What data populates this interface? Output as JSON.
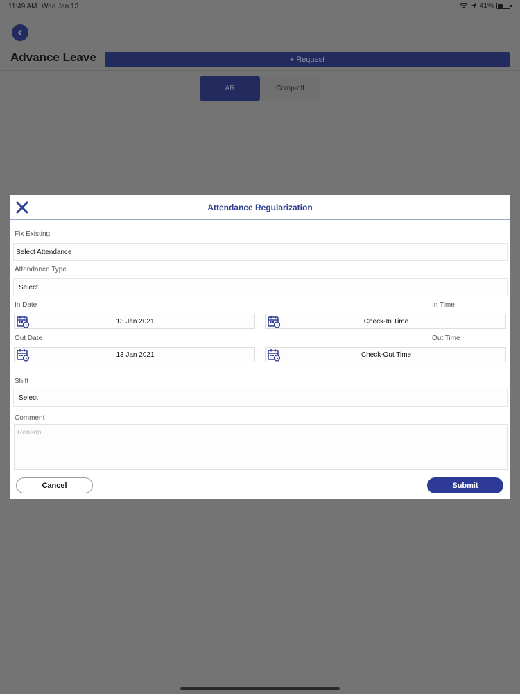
{
  "status_bar": {
    "time": "11:49 AM",
    "date": "Wed Jan 13",
    "battery_text": "41%",
    "battery_level": 0.41
  },
  "header": {
    "back_icon": "chevron-left-icon",
    "title": "Advance Leave",
    "request_label": "+ Request"
  },
  "segments": [
    {
      "label": "AR",
      "active": true
    },
    {
      "label": "Comp-off",
      "active": false
    }
  ],
  "modal": {
    "close_icon": "close-icon",
    "title": "Attendance Regularization",
    "fix_existing": {
      "label": "Fix Existing",
      "value": "Select Attendance"
    },
    "attendance_type": {
      "label": "Attendance Type",
      "value": "Select"
    },
    "in_date": {
      "label": "In Date",
      "value": "13 Jan 2021"
    },
    "in_time": {
      "label": "In Time",
      "value": "Check-In Time"
    },
    "out_date": {
      "label": "Out Date",
      "value": "13 Jan 2021"
    },
    "out_time": {
      "label": "Out Time",
      "value": "Check-Out Time"
    },
    "shift": {
      "label": "Shift",
      "value": "Select"
    },
    "comment": {
      "label": "Comment",
      "placeholder": "Reason",
      "value": ""
    },
    "cancel_label": "Cancel",
    "submit_label": "Submit"
  },
  "colors": {
    "accent": "#2e3b96",
    "title_blue": "#2e3f8f",
    "overlay": "#747474"
  }
}
